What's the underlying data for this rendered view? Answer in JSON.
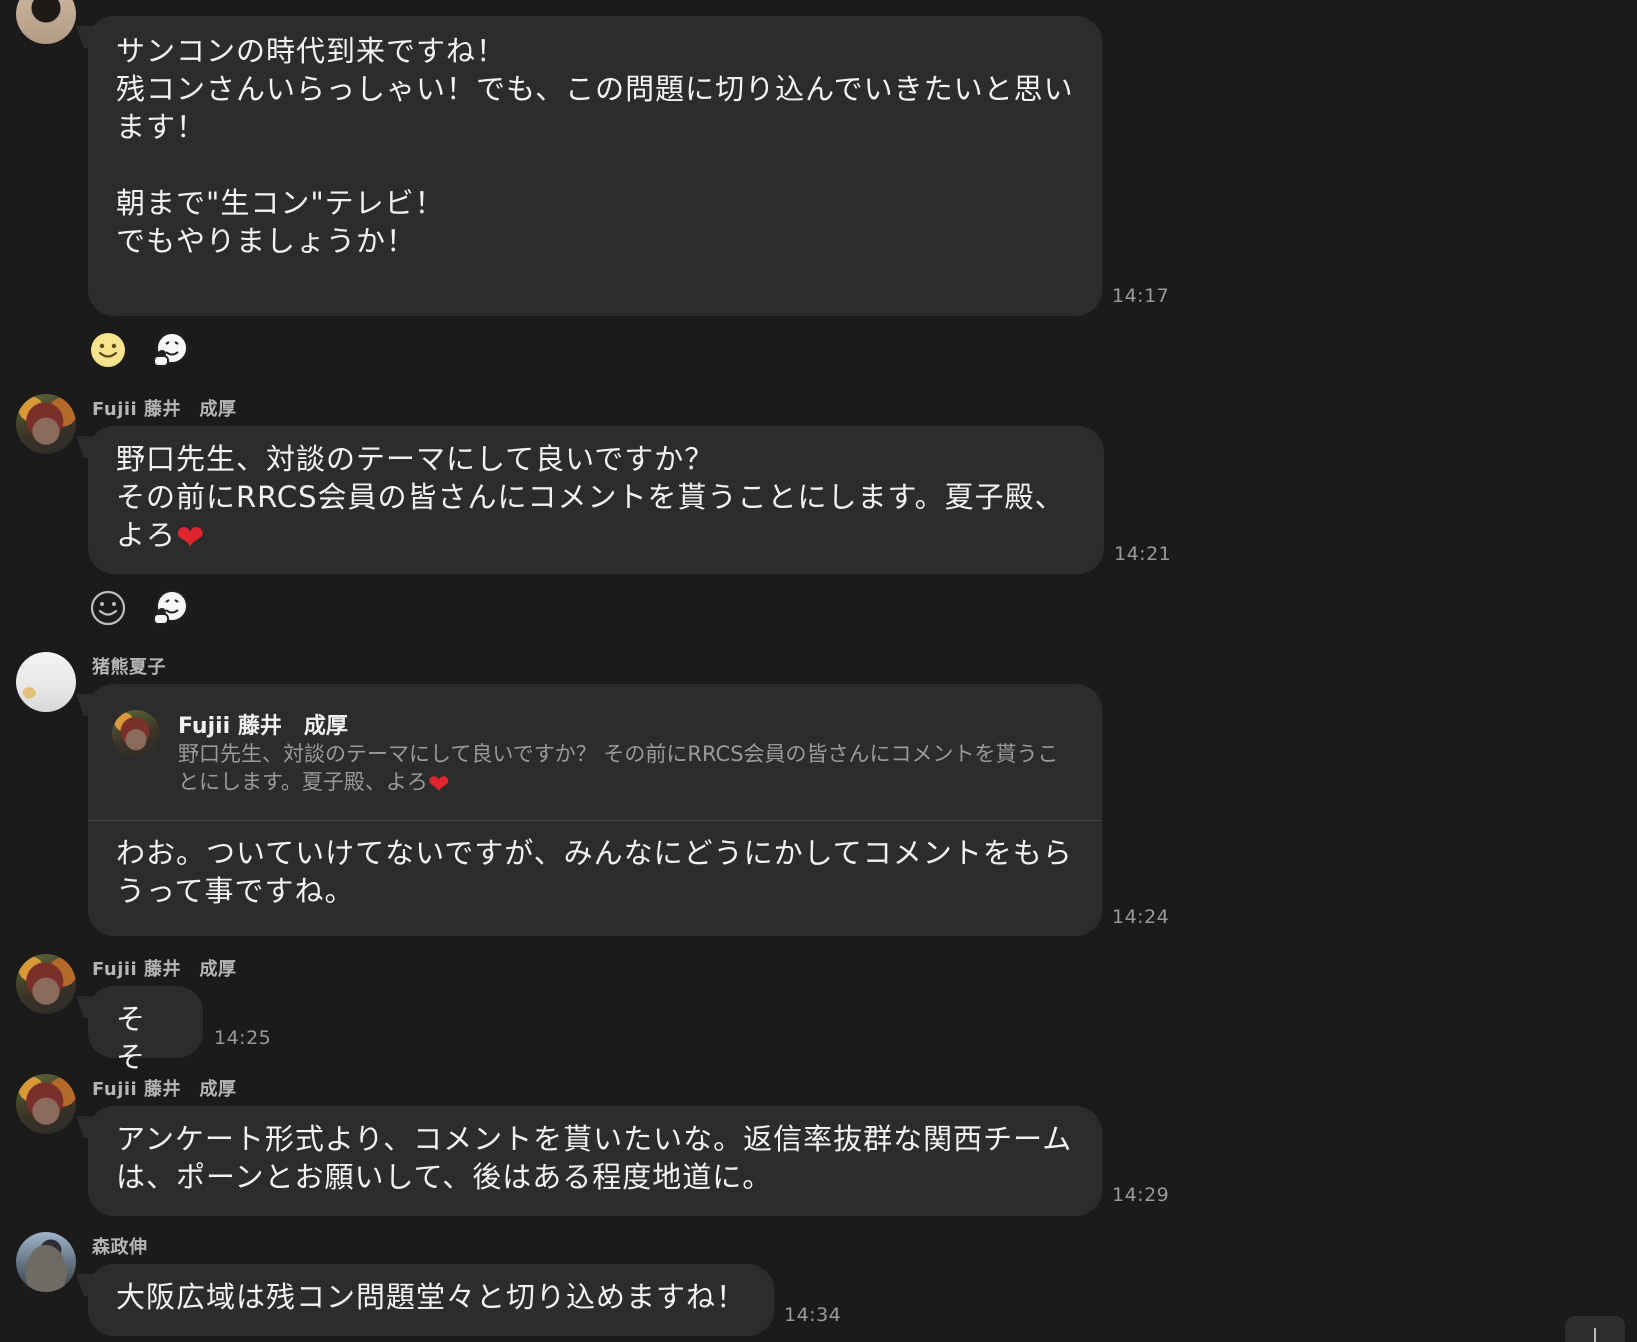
{
  "messages": [
    {
      "text": "サンコンの時代到来ですね！\n残コンさんいらっしゃい！でも、この問題に切り込んでいきたいと思います！\n\n朝まで\"生コン\"テレビ！\nでもやりましょうか！",
      "time": "14:17",
      "reactions": [
        "smile-emoji",
        "hugging-face-sticker"
      ]
    },
    {
      "sender": "Fujii 藤井　成厚",
      "text": "野口先生、対談のテーマにして良いですか？\nその前にRRCS会員の皆さんにコメントを貰うことにします。夏子殿、よろ",
      "emoji": "❤",
      "time": "14:21",
      "reactions": [
        "add-reaction",
        "hugging-face-sticker"
      ]
    },
    {
      "sender": "猪熊夏子",
      "quote_sender": "Fujii 藤井　成厚",
      "quote_text": "野口先生、対談のテーマにして良いですか？ その前にRRCS会員の皆さんにコメントを貰うことにします。夏子殿、よろ",
      "quote_emoji": "❤",
      "text": "わお。ついていけてないですが、みんなにどうにかしてコメントをもらうって事ですね。",
      "time": "14:24"
    },
    {
      "sender": "Fujii 藤井　成厚",
      "text": "そそ",
      "time": "14:25"
    },
    {
      "sender": "Fujii 藤井　成厚",
      "text": "アンケート形式より、コメントを貰いたいな。返信率抜群な関西チームは、ポーンとお願いして、後はある程度地道に。",
      "time": "14:29"
    },
    {
      "sender": "森政伸",
      "text": "大阪広域は残コン問題堂々と切り込めますね！",
      "time": "14:34"
    }
  ],
  "colors": {
    "background": "#1b1b1b",
    "bubble": "#2c2c2c",
    "sender": "#b5b5b5",
    "time": "#9a9a9a",
    "heart": "#e0252e"
  }
}
